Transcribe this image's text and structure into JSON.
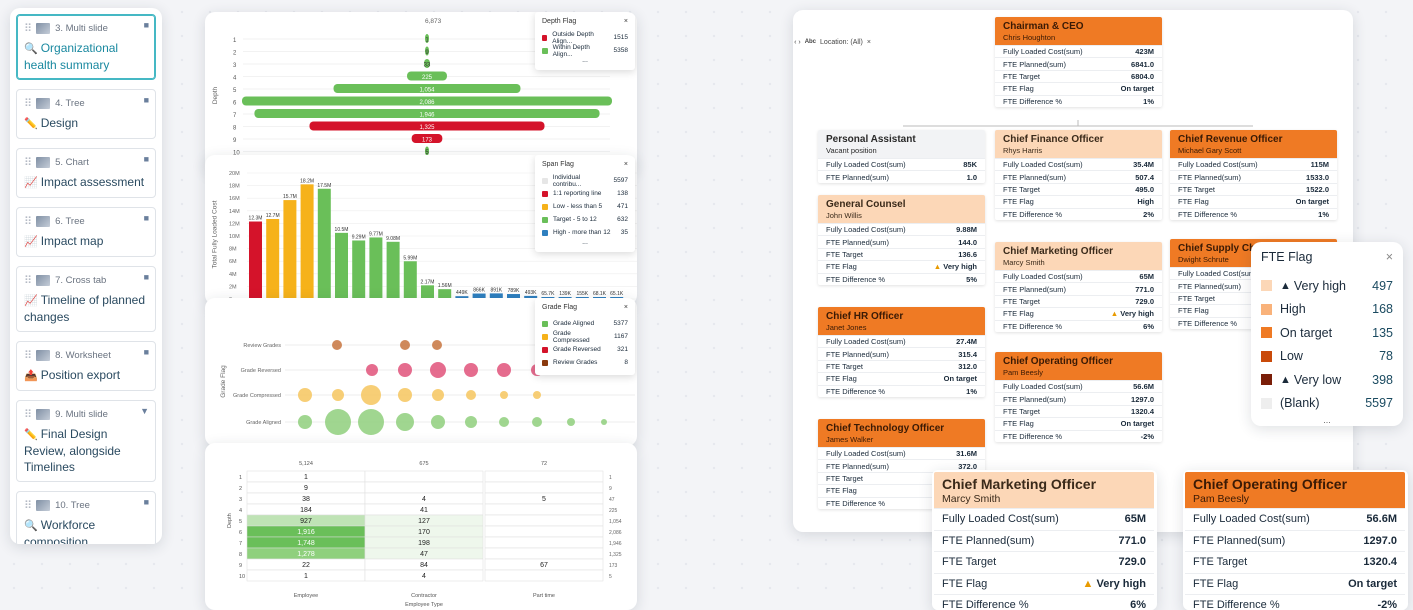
{
  "sidebar": {
    "items": [
      {
        "num": "3. Multi slide",
        "title": "Organizational health summary",
        "icon": "search-icon"
      },
      {
        "num": "4. Tree",
        "title": "Design",
        "icon": "pencil-icon"
      },
      {
        "num": "5. Chart",
        "title": "Impact assessment",
        "icon": "chart-icon"
      },
      {
        "num": "6. Tree",
        "title": "Impact map",
        "icon": "chart-icon"
      },
      {
        "num": "7. Cross tab",
        "title": "Timeline of planned changes",
        "icon": "chart-icon"
      },
      {
        "num": "8. Worksheet",
        "title": "Position export",
        "icon": "export-icon"
      },
      {
        "num": "9. Multi slide",
        "title": "Final Design Review, alongside Timelines",
        "icon": "pencil-icon"
      },
      {
        "num": "10. Tree",
        "title": "Workforce composition",
        "icon": "search-icon"
      }
    ]
  },
  "depth_chart": {
    "top": "6,873",
    "ylabel": "Depth",
    "legend_title": "Depth Flag",
    "legend": [
      {
        "name": "Outside Depth Align...",
        "value": "1515",
        "color": "#d4132a"
      },
      {
        "name": "Within Depth Align...",
        "value": "5358",
        "color": "#6abf59"
      }
    ],
    "more": "..."
  },
  "span_chart": {
    "ylabel": "Total Fully Loaded Cost",
    "legend_title": "Span Flag",
    "legend": [
      {
        "name": "Individual contribu...",
        "value": "5597",
        "color": "#e6e6e6"
      },
      {
        "name": "1:1 reporting line",
        "value": "138",
        "color": "#d4132a"
      },
      {
        "name": "Low - less than 5",
        "value": "471",
        "color": "#f6b21a"
      },
      {
        "name": "Target - 5 to 12",
        "value": "632",
        "color": "#6abf59"
      },
      {
        "name": "High - more than 12",
        "value": "35",
        "color": "#2e7fbf"
      }
    ],
    "more": "..."
  },
  "grade_chart": {
    "ylabel": "Grade Flag",
    "rows": [
      "Review Grades",
      "Grade Reversed",
      "Grade Compressed",
      "Grade Aligned"
    ],
    "legend_title": "Grade Flag",
    "legend": [
      {
        "name": "Grade Aligned",
        "value": "5377",
        "color": "#6abf59"
      },
      {
        "name": "Grade Compressed",
        "value": "1167",
        "color": "#f6b21a"
      },
      {
        "name": "Grade Reversed",
        "value": "321",
        "color": "#d4132a"
      },
      {
        "name": "Review Grades",
        "value": "8",
        "color": "#8a3a0e"
      }
    ]
  },
  "crosstab": {
    "cols": [
      "5,124",
      "675",
      "72"
    ],
    "rowlabel": "Depth",
    "xlabels": [
      "Employee",
      "Contractor",
      "Part time"
    ],
    "xtitle": "Employee Type"
  },
  "org": {
    "filter": "Location: (All)",
    "ceo": {
      "title": "Chairman & CEO",
      "name": "Chris Houghton",
      "rows": [
        [
          "Fully Loaded Cost(sum)",
          "423M"
        ],
        [
          "FTE Planned(sum)",
          "6841.0"
        ],
        [
          "FTE Target",
          "6804.0"
        ],
        [
          "FTE Flag",
          "On target"
        ],
        [
          "FTE Difference %",
          "1%"
        ]
      ]
    },
    "pa": {
      "title": "Personal Assistant",
      "name": "Vacant position",
      "rows": [
        [
          "Fully Loaded Cost(sum)",
          "85K"
        ],
        [
          "FTE Planned(sum)",
          "1.0"
        ]
      ]
    },
    "gc": {
      "title": "General Counsel",
      "name": "John Willis",
      "rows": [
        [
          "Fully Loaded Cost(sum)",
          "9.88M"
        ],
        [
          "FTE Planned(sum)",
          "144.0"
        ],
        [
          "FTE Target",
          "136.6"
        ],
        [
          "FTE Flag",
          "Very high"
        ],
        [
          "FTE Difference %",
          "5%"
        ]
      ]
    },
    "hr": {
      "title": "Chief HR Officer",
      "name": "Janet Jones",
      "rows": [
        [
          "Fully Loaded Cost(sum)",
          "27.4M"
        ],
        [
          "FTE Planned(sum)",
          "315.4"
        ],
        [
          "FTE Target",
          "312.0"
        ],
        [
          "FTE Flag",
          "On target"
        ],
        [
          "FTE Difference %",
          "1%"
        ]
      ]
    },
    "cto": {
      "title": "Chief Technology Officer",
      "name": "James Walker",
      "rows": [
        [
          "Fully Loaded Cost(sum)",
          "31.6M"
        ],
        [
          "FTE Planned(sum)",
          "372.0"
        ],
        [
          "FTE Target",
          ""
        ],
        [
          "FTE Flag",
          ""
        ],
        [
          "FTE Difference %",
          ""
        ]
      ]
    },
    "cfo": {
      "title": "Chief Finance Officer",
      "name": "Rhys Harris",
      "rows": [
        [
          "Fully Loaded Cost(sum)",
          "35.4M"
        ],
        [
          "FTE Planned(sum)",
          "507.4"
        ],
        [
          "FTE Target",
          "495.0"
        ],
        [
          "FTE Flag",
          "High"
        ],
        [
          "FTE Difference %",
          "2%"
        ]
      ]
    },
    "cmo": {
      "title": "Chief Marketing Officer",
      "name": "Marcy Smith",
      "rows": [
        [
          "Fully Loaded Cost(sum)",
          "65M"
        ],
        [
          "FTE Planned(sum)",
          "771.0"
        ],
        [
          "FTE Target",
          "729.0"
        ],
        [
          "FTE Flag",
          "Very high"
        ],
        [
          "FTE Difference %",
          "6%"
        ]
      ]
    },
    "coo": {
      "title": "Chief Operating Officer",
      "name": "Pam Beesly",
      "rows": [
        [
          "Fully Loaded Cost(sum)",
          "56.6M"
        ],
        [
          "FTE Planned(sum)",
          "1297.0"
        ],
        [
          "FTE Target",
          "1320.4"
        ],
        [
          "FTE Flag",
          "On target"
        ],
        [
          "FTE Difference %",
          "-2%"
        ]
      ]
    },
    "cro": {
      "title": "Chief Revenue Officer",
      "name": "Michael Gary Scott",
      "rows": [
        [
          "Fully Loaded Cost(sum)",
          "115M"
        ],
        [
          "FTE Planned(sum)",
          "1533.0"
        ],
        [
          "FTE Target",
          "1522.0"
        ],
        [
          "FTE Flag",
          "On target"
        ],
        [
          "FTE Difference %",
          "1%"
        ]
      ]
    },
    "csc": {
      "title": "Chief Supply Ch",
      "name": "Dwight Schrute",
      "rows": [
        [
          "Fully Loaded Cost(sum)",
          ""
        ],
        [
          "FTE Planned(sum)",
          ""
        ],
        [
          "FTE Target",
          ""
        ],
        [
          "FTE Flag",
          ""
        ],
        [
          "FTE Difference %",
          ""
        ]
      ]
    }
  },
  "fte_flag": {
    "title": "FTE Flag",
    "items": [
      {
        "label": "Very high",
        "value": "497",
        "color": "#fcd7b7",
        "warn": true
      },
      {
        "label": "High",
        "value": "168",
        "color": "#f9b27a"
      },
      {
        "label": "On target",
        "value": "135",
        "color": "#ef7a24"
      },
      {
        "label": "Low",
        "value": "78",
        "color": "#c94a0a"
      },
      {
        "label": "Very low",
        "value": "398",
        "color": "#7a1e08",
        "warn": true
      },
      {
        "label": "(Blank)",
        "value": "5597",
        "color": "#eeeeee"
      }
    ],
    "more": "..."
  }
}
